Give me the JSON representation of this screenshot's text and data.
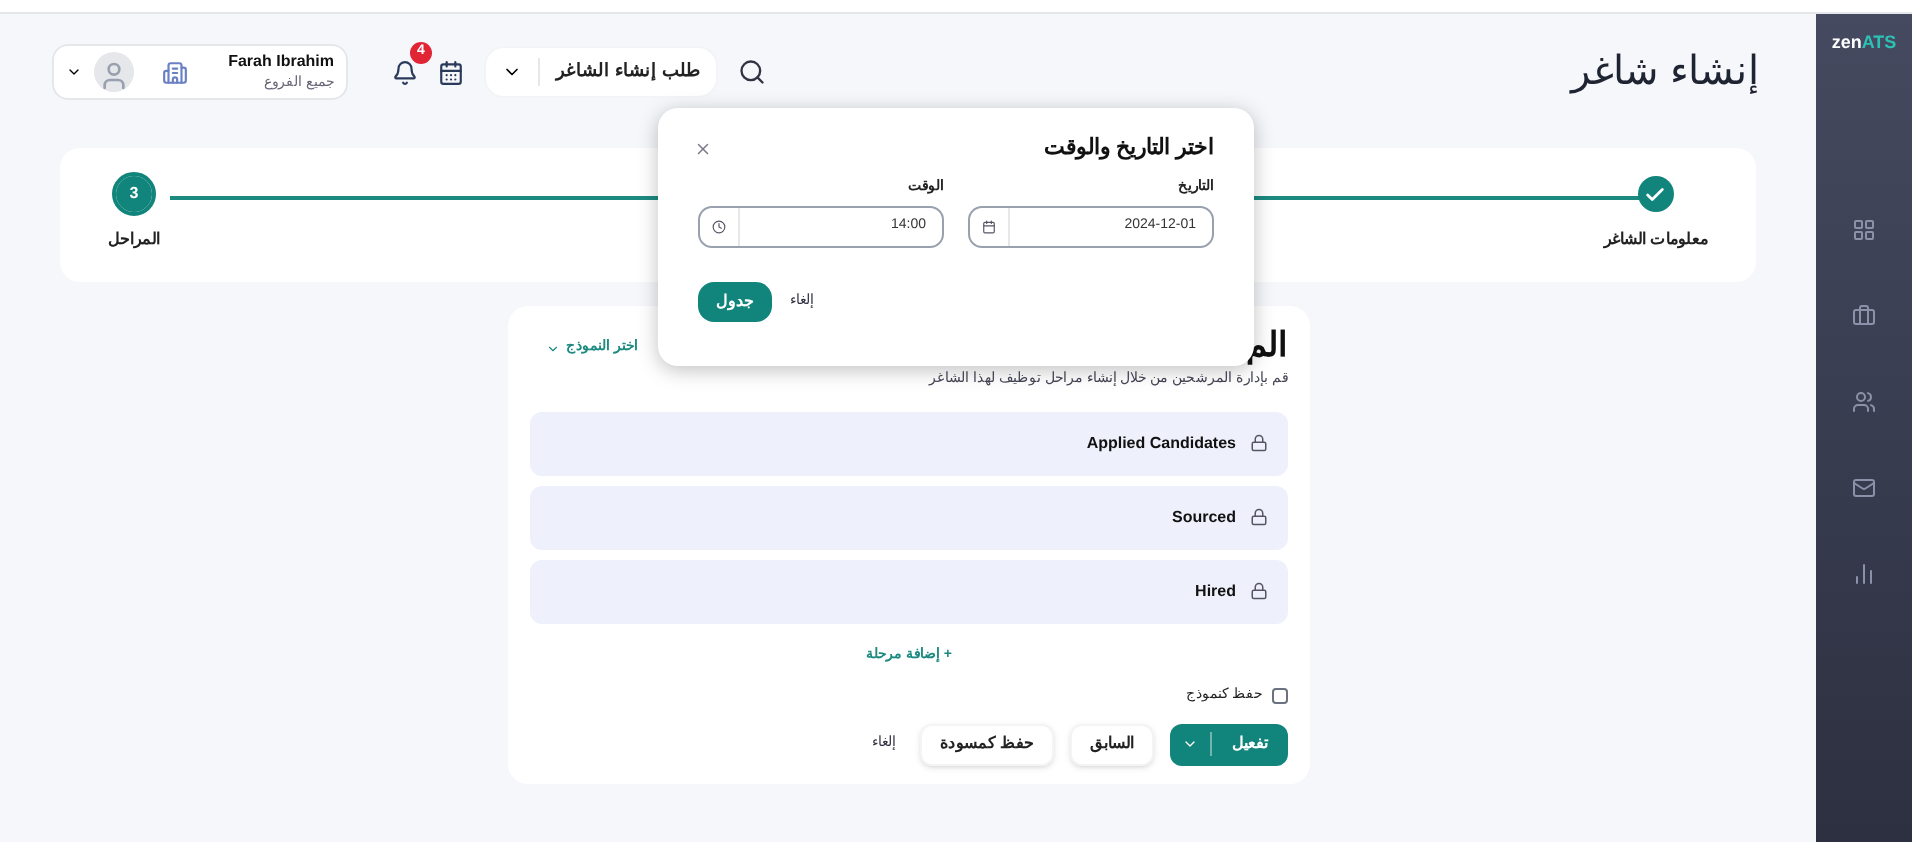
{
  "logo": {
    "part1": "zen",
    "part2": "ATS"
  },
  "sidebar": {
    "items": [
      {
        "kind": "grid",
        "selected": false
      },
      {
        "kind": "briefcase",
        "selected": false
      },
      {
        "kind": "users",
        "selected": false
      },
      {
        "kind": "mail",
        "selected": false
      },
      {
        "kind": "chart",
        "selected": false
      }
    ]
  },
  "header": {
    "title": "إنشاء شاغر",
    "request_button": "طلب إنشاء الشاغر",
    "notifications": "4",
    "user": {
      "name": "Farah Ibrahim",
      "branch": "جميع الفروع"
    }
  },
  "steps": [
    {
      "label": "معلومات الشاغر",
      "completed": true
    },
    {
      "label": "المراحل",
      "completed": false,
      "number": "3"
    }
  ],
  "stages_card": {
    "title": "الم",
    "template_link": "اختر النموذج",
    "subtitle": "قم بإدارة المرشحين من خلال إنشاء مراحل توظيف لهذا الشاغر",
    "stages": [
      {
        "name": "Applied Candidates",
        "locked": true
      },
      {
        "name": "Sourced",
        "locked": true
      },
      {
        "name": "Hired",
        "locked": true
      }
    ],
    "add_stage": "+ إضافة مرحلة",
    "save_template": {
      "label": "حفظ كنموذج",
      "checked": false
    },
    "buttons": {
      "activate": "تفعيل",
      "previous": "السابق",
      "draft": "حفظ كمسودة",
      "cancel": "إلغاء"
    }
  },
  "dialog": {
    "title": "اختر التاريخ والوقت",
    "date": {
      "label": "التاريخ",
      "value": "2024-12-01"
    },
    "time": {
      "label": "الوقت",
      "value": "14:00"
    },
    "confirm": "جدول",
    "cancel": "إلغاء"
  }
}
